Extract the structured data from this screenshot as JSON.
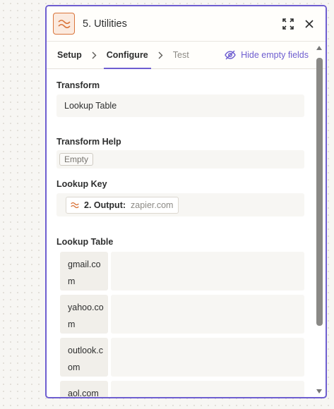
{
  "step": {
    "title": "5. Utilities",
    "icon": "transform-wave-icon"
  },
  "header_buttons": {
    "expand_icon": "expand-icon",
    "close_icon": "close-icon"
  },
  "tabs": [
    {
      "label": "Setup",
      "state": "done"
    },
    {
      "label": "Configure",
      "state": "active"
    },
    {
      "label": "Test",
      "state": "disabled"
    }
  ],
  "hide_empty_fields": {
    "label": "Hide empty fields",
    "icon": "eye-off-icon"
  },
  "fields": {
    "transform": {
      "label": "Transform",
      "value": "Lookup Table"
    },
    "transform_help": {
      "label": "Transform Help",
      "value": "Empty"
    },
    "lookup_key": {
      "label": "Lookup Key",
      "pill_label": "2. Output:",
      "pill_value": "zapier.com"
    },
    "lookup_table": {
      "label": "Lookup Table",
      "rows": [
        {
          "key": "gmail.com",
          "value": ""
        },
        {
          "key": "yahoo.com",
          "value": ""
        },
        {
          "key": "outlook.com",
          "value": ""
        },
        {
          "key": "aol.com",
          "value": ""
        }
      ]
    }
  },
  "colors": {
    "accent": "#6e5ed0",
    "app_orange": "#d9753b",
    "field_bg": "#f7f6f3"
  }
}
